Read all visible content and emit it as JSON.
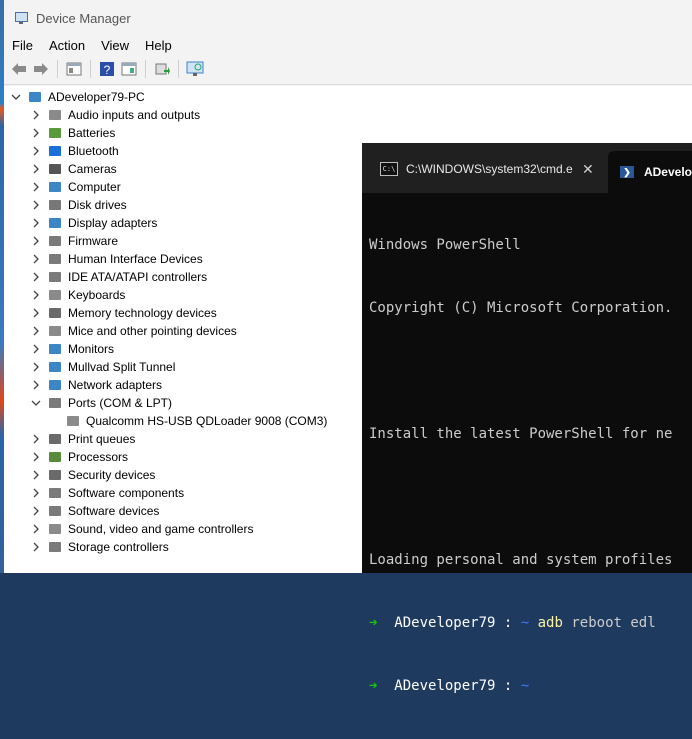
{
  "window": {
    "title": "Device Manager"
  },
  "menu": [
    "File",
    "Action",
    "View",
    "Help"
  ],
  "tree": {
    "root": "ADeveloper79-PC",
    "categories": [
      {
        "label": "Audio inputs and outputs",
        "icon": "speaker-icon",
        "color": "#8a8a8a"
      },
      {
        "label": "Batteries",
        "icon": "battery-icon",
        "color": "#5a9a3c"
      },
      {
        "label": "Bluetooth",
        "icon": "bluetooth-icon",
        "color": "#1a6fd8"
      },
      {
        "label": "Cameras",
        "icon": "camera-icon",
        "color": "#555555"
      },
      {
        "label": "Computer",
        "icon": "computer-icon",
        "color": "#3d86c6"
      },
      {
        "label": "Disk drives",
        "icon": "disk-icon",
        "color": "#777777"
      },
      {
        "label": "Display adapters",
        "icon": "display-adapter-icon",
        "color": "#3d86c6"
      },
      {
        "label": "Firmware",
        "icon": "firmware-icon",
        "color": "#7a7a7a"
      },
      {
        "label": "Human Interface Devices",
        "icon": "hid-icon",
        "color": "#7a7a7a"
      },
      {
        "label": "IDE ATA/ATAPI controllers",
        "icon": "ide-icon",
        "color": "#7a7a7a"
      },
      {
        "label": "Keyboards",
        "icon": "keyboard-icon",
        "color": "#8a8a8a"
      },
      {
        "label": "Memory technology devices",
        "icon": "memory-icon",
        "color": "#6a6a6a"
      },
      {
        "label": "Mice and other pointing devices",
        "icon": "mouse-icon",
        "color": "#8a8a8a"
      },
      {
        "label": "Monitors",
        "icon": "monitor-icon",
        "color": "#3d86c6"
      },
      {
        "label": "Mullvad Split Tunnel",
        "icon": "network-icon",
        "color": "#3d86c6"
      },
      {
        "label": "Network adapters",
        "icon": "network-adapter-icon",
        "color": "#3d86c6"
      },
      {
        "label": "Ports (COM & LPT)",
        "icon": "port-icon",
        "color": "#7a7a7a",
        "expanded": true,
        "children": [
          {
            "label": "Qualcomm HS-USB QDLoader 9008 (COM3)",
            "icon": "port-device-icon"
          }
        ]
      },
      {
        "label": "Print queues",
        "icon": "printer-icon",
        "color": "#6a6a6a"
      },
      {
        "label": "Processors",
        "icon": "processor-icon",
        "color": "#5a8a3c"
      },
      {
        "label": "Security devices",
        "icon": "security-icon",
        "color": "#6a6a6a"
      },
      {
        "label": "Software components",
        "icon": "software-component-icon",
        "color": "#7a7a7a"
      },
      {
        "label": "Software devices",
        "icon": "software-device-icon",
        "color": "#7a7a7a"
      },
      {
        "label": "Sound, video and game controllers",
        "icon": "sound-icon",
        "color": "#8a8a8a"
      },
      {
        "label": "Storage controllers",
        "icon": "storage-icon",
        "color": "#7a7a7a"
      }
    ]
  },
  "terminal": {
    "tabs": [
      {
        "title": "C:\\WINDOWS\\system32\\cmd.e",
        "icon": "cmd-icon",
        "close": "✕"
      },
      {
        "title": "ADevelo",
        "icon": "powershell-icon"
      }
    ],
    "lines": [
      "Windows PowerShell",
      "Copyright (C) Microsoft Corporation.",
      "",
      "Install the latest PowerShell for ne",
      "",
      "Loading personal and system profiles"
    ],
    "prompts": [
      {
        "arrow": "➜",
        "user": "ADeveloper79",
        "sep": " : ",
        "dir": "~",
        "cmd": "adb",
        "args": " reboot edl"
      },
      {
        "arrow": "➜",
        "user": "ADeveloper79",
        "sep": " : ",
        "dir": "~",
        "cmd": "",
        "args": ""
      }
    ]
  }
}
